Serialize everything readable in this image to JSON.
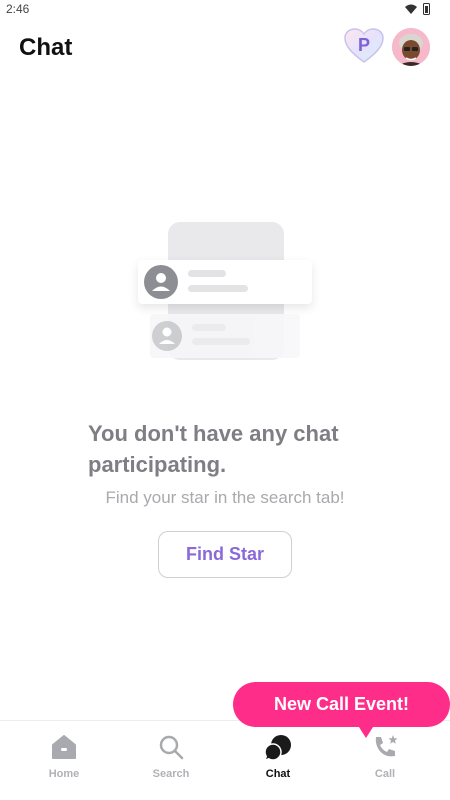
{
  "status_bar": {
    "time": "2:46"
  },
  "header": {
    "title": "Chat",
    "premium_badge_letter": "P"
  },
  "empty_state": {
    "title": "You don't have any chat participating.",
    "subtitle": "Find your star in the search tab!",
    "button_label": "Find Star"
  },
  "banner": {
    "label": "New Call Event!"
  },
  "bottom_nav": {
    "items": [
      {
        "label": "Home",
        "icon": "home-icon"
      },
      {
        "label": "Search",
        "icon": "search-icon"
      },
      {
        "label": "Chat",
        "icon": "chat-icon",
        "active": true
      },
      {
        "label": "Call",
        "icon": "call-star-icon"
      }
    ]
  },
  "colors": {
    "accent_purple": "#8a6ad9",
    "banner_pink": "#ff2d8a",
    "muted_text": "#a9a9ae"
  }
}
